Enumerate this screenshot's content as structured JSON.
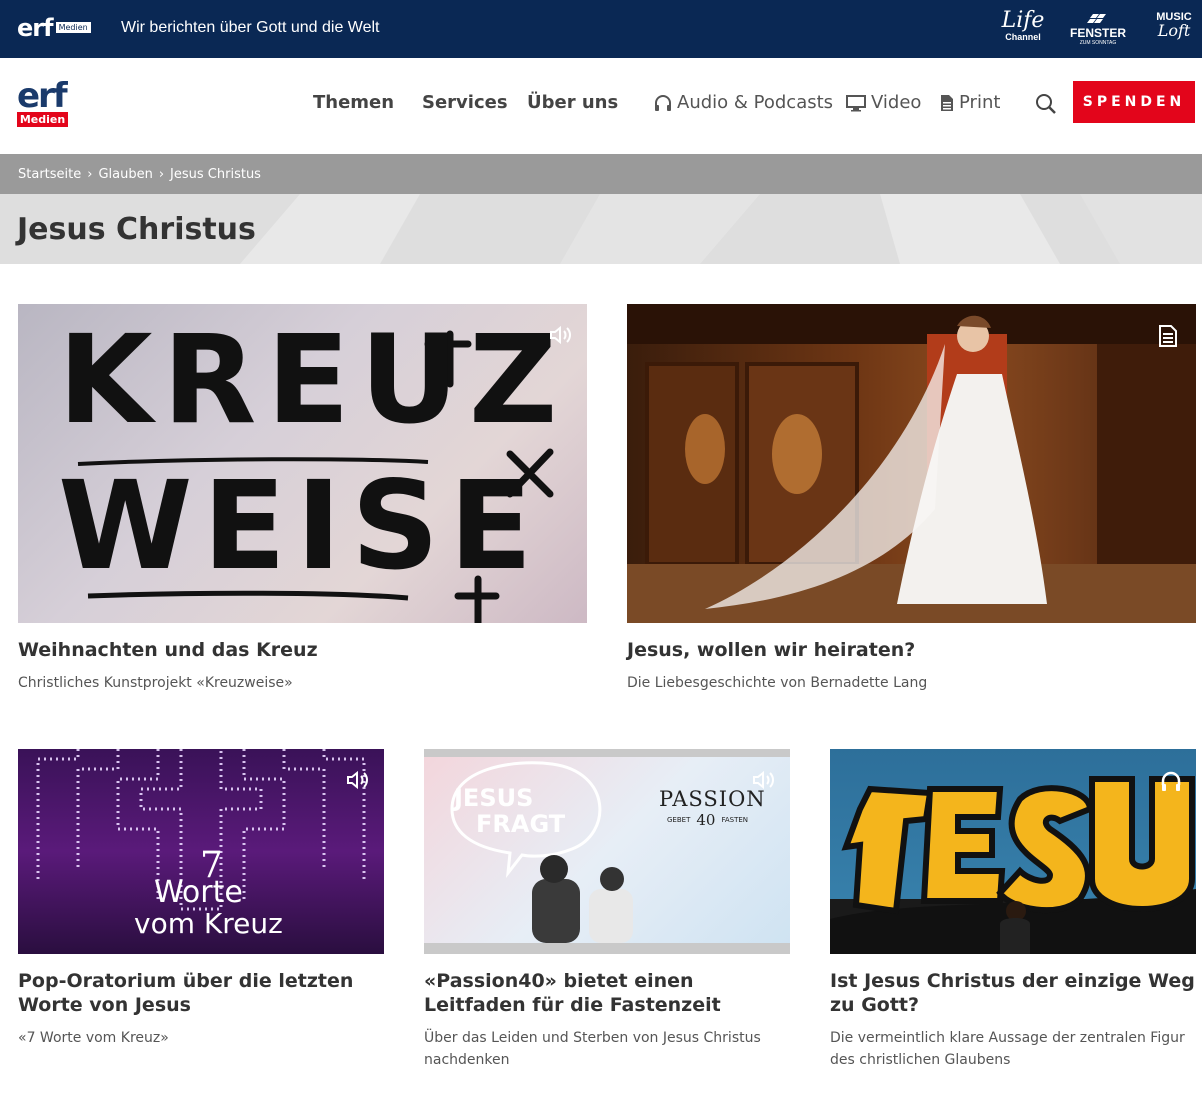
{
  "topbar": {
    "logo": "erf",
    "logo_tag": "Medien",
    "slogan": "Wir berichten über Gott und die Welt",
    "partners": {
      "life_big": "Life",
      "life_small": "Channel",
      "fenster": "FENSTER",
      "fenster_small": "ZUM SONNTAG",
      "music_big": "MUSIC",
      "music_small": "Loft"
    }
  },
  "header": {
    "logo": "erf",
    "logo_tag": "Medien",
    "nav": [
      "Themen",
      "Services",
      "Über uns"
    ],
    "media_nav": [
      {
        "label": "Audio & Podcasts",
        "icon": "headphones-icon"
      },
      {
        "label": "Video",
        "icon": "monitor-icon"
      },
      {
        "label": "Print",
        "icon": "document-icon"
      }
    ],
    "donate_label": "SPENDEN"
  },
  "breadcrumb": [
    "Startseite",
    "Glauben",
    "Jesus Christus"
  ],
  "page_title": "Jesus Christus",
  "cards": [
    {
      "title": "Weihnachten und das Kreuz",
      "subtitle": "Christliches Kunstprojekt «Kreuzweise»",
      "media": "audio",
      "image_text": [
        "KREUZ",
        "WEISE"
      ]
    },
    {
      "title": "Jesus, wollen wir heiraten?",
      "subtitle": "Die Liebesgeschichte von Bernadette Lang",
      "media": "article"
    },
    {
      "title": "Pop-Oratorium über die letzten Worte von Jesus",
      "subtitle": "«7 Worte vom Kreuz»",
      "media": "audio",
      "image_text": [
        "7",
        "Worte",
        "vom Kreuz"
      ]
    },
    {
      "title": "«Passion40» bietet einen Leitfaden für die Fastenzeit",
      "subtitle": "Über das Leiden und Sterben von Jesus Christus nachdenken",
      "media": "audio",
      "image_text": [
        "JESUS",
        "FRAGT",
        "PASSION",
        "GEBET",
        "40",
        "FASTEN"
      ]
    },
    {
      "title": "Ist Jesus Christus der einzige Weg zu Gott?",
      "subtitle": "Die vermeintlich klare Aussage der zentralen Figur des christlichen Glaubens",
      "media": "podcast",
      "image_text": [
        "JESUS"
      ]
    }
  ],
  "colors": {
    "topbar": "#0a2854",
    "accent_red": "#e3051b",
    "breadcrumb_bg": "#9a9a9a",
    "banner_bg": "#dedede"
  }
}
